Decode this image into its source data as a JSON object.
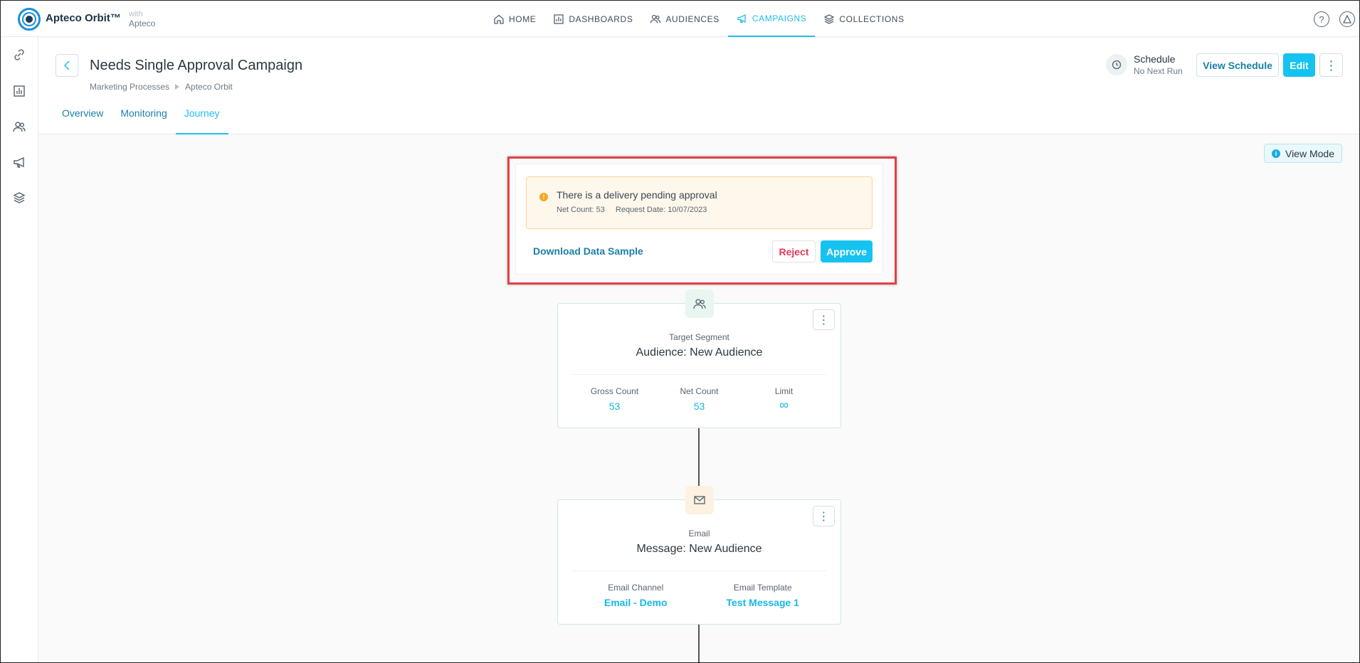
{
  "app": {
    "name": "Apteco Orbit™",
    "with_label": "with",
    "with_brand": "Apteco"
  },
  "nav": {
    "items": [
      {
        "label": "HOME",
        "icon": "home-icon"
      },
      {
        "label": "DASHBOARDS",
        "icon": "chart-icon"
      },
      {
        "label": "AUDIENCES",
        "icon": "users-icon"
      },
      {
        "label": "CAMPAIGNS",
        "icon": "megaphone-icon",
        "active": true
      },
      {
        "label": "COLLECTIONS",
        "icon": "layers-icon"
      }
    ],
    "help_icon": "?"
  },
  "sidebar": {
    "icons": [
      "link-icon",
      "chart-icon",
      "users-icon",
      "megaphone-icon",
      "layers-icon"
    ]
  },
  "page": {
    "title": "Needs Single Approval Campaign",
    "breadcrumb": [
      "Marketing Processes",
      "Apteco Orbit"
    ],
    "tabs": [
      "Overview",
      "Monitoring",
      "Journey"
    ],
    "active_tab": "Journey",
    "schedule": {
      "title": "Schedule",
      "subtitle": "No Next Run"
    },
    "buttons": {
      "view_schedule": "View Schedule",
      "edit": "Edit"
    }
  },
  "canvas": {
    "view_mode_label": "View Mode",
    "approval": {
      "message": "There is a delivery pending approval",
      "net_count_label": "Net Count:",
      "net_count": "53",
      "request_date_label": "Request Date:",
      "request_date": "10/07/2023",
      "download_label": "Download Data Sample",
      "reject_label": "Reject",
      "approve_label": "Approve"
    },
    "nodes": [
      {
        "type": "Target Segment",
        "title": "Audience: New Audience",
        "stats": [
          {
            "label": "Gross Count",
            "value": "53"
          },
          {
            "label": "Net Count",
            "value": "53"
          },
          {
            "label": "Limit",
            "value": "∞"
          }
        ]
      },
      {
        "type": "Email",
        "title": "Message: New Audience",
        "stats": [
          {
            "label": "Email Channel",
            "value": "Email - Demo"
          },
          {
            "label": "Email Template",
            "value": "Test Message 1"
          }
        ]
      }
    ]
  },
  "colors": {
    "accent": "#16c3f0",
    "link": "#1a7fa8",
    "warning": "#f5a623",
    "danger": "#e03a5b",
    "highlight": "#e0414a"
  }
}
